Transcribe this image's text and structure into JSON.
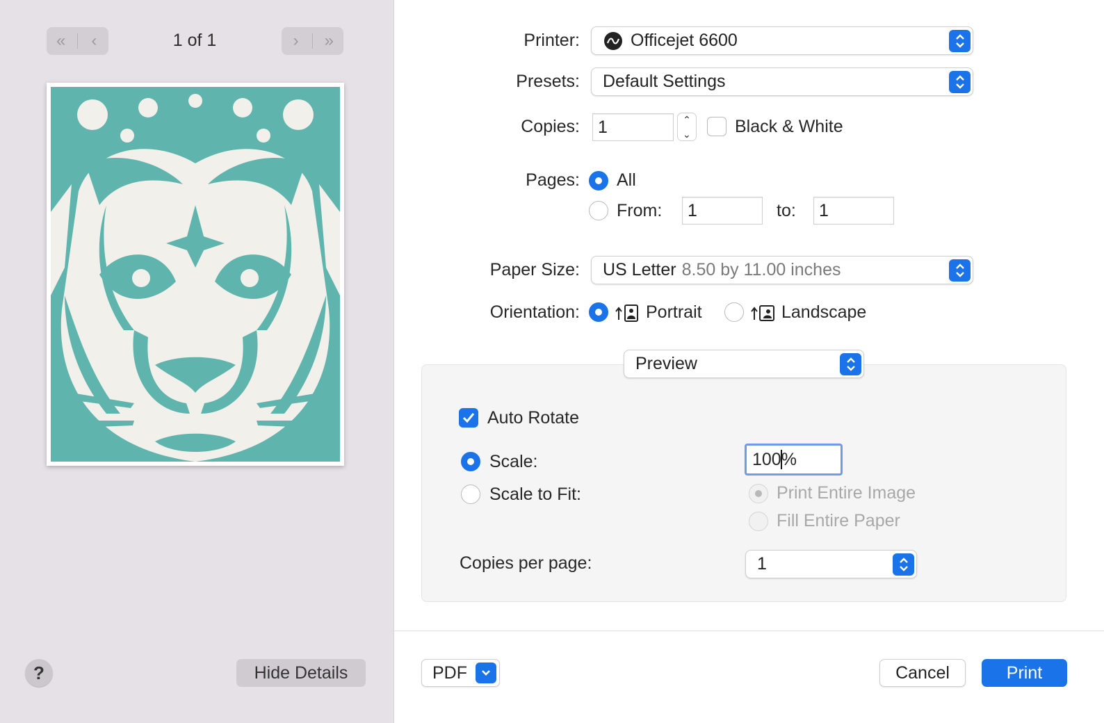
{
  "preview_pane": {
    "page_indicator": "1 of 1",
    "hide_details_label": "Hide Details",
    "help_label": "?"
  },
  "form": {
    "printer_label": "Printer:",
    "printer_value": "Officejet 6600",
    "presets_label": "Presets:",
    "presets_value": "Default Settings",
    "copies_label": "Copies:",
    "copies_value": "1",
    "bw_label": "Black & White",
    "bw_checked": false,
    "pages_label": "Pages:",
    "pages_all_label": "All",
    "pages_from_label": "From:",
    "pages_from_value": "1",
    "pages_to_label": "to:",
    "pages_to_value": "1",
    "paper_size_label": "Paper Size:",
    "paper_size_value": "US Letter",
    "paper_size_detail": "8.50 by 11.00 inches",
    "orientation_label": "Orientation:",
    "orientation_portrait": "Portrait",
    "orientation_landscape": "Landscape",
    "section_value": "Preview"
  },
  "preview_options": {
    "auto_rotate_label": "Auto Rotate",
    "auto_rotate_checked": true,
    "scale_label": "Scale:",
    "scale_value_number": "100",
    "scale_value_unit": "%",
    "scale_to_fit_label": "Scale to Fit:",
    "print_entire_image_label": "Print Entire Image",
    "fill_entire_paper_label": "Fill Entire Paper",
    "copies_per_page_label": "Copies per page:",
    "copies_per_page_value": "1"
  },
  "footer": {
    "pdf_label": "PDF",
    "cancel_label": "Cancel",
    "print_label": "Print"
  },
  "colors": {
    "accent": "#1a73e8",
    "artwork_teal": "#5fb5ad",
    "artwork_paper": "#f2f0ea",
    "artwork_shadow": "#e8a2a2"
  }
}
